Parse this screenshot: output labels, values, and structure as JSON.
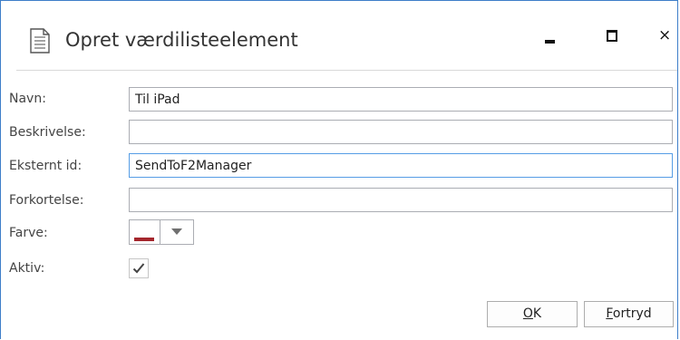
{
  "window": {
    "title": "Opret værdilisteelement",
    "controls": {
      "minimize": "minimize",
      "maximize": "maximize",
      "close": "×"
    }
  },
  "form": {
    "name": {
      "label": "Navn:",
      "value": "Til iPad"
    },
    "description": {
      "label": "Beskrivelse:",
      "value": ""
    },
    "external_id": {
      "label": "Eksternt id:",
      "value": "SendToF2Manager"
    },
    "abbreviation": {
      "label": "Forkortelse:",
      "value": ""
    },
    "color": {
      "label": "Farve:",
      "swatch_color": "#a4262c"
    },
    "active": {
      "label": "Aktiv:",
      "checked": true
    }
  },
  "buttons": {
    "ok": {
      "accel": "O",
      "rest": "K"
    },
    "cancel": {
      "accel": "F",
      "rest": "ortryd"
    }
  },
  "icons": {
    "title": "document-icon",
    "minimize": "minimize-icon",
    "maximize": "maximize-icon",
    "close": "close-icon",
    "dropdown": "chevron-down-icon",
    "checkmark": "checkmark-icon"
  },
  "colors": {
    "window_border": "#3d7ec9",
    "focus_border": "#569de5",
    "field_border": "#abadb3"
  }
}
